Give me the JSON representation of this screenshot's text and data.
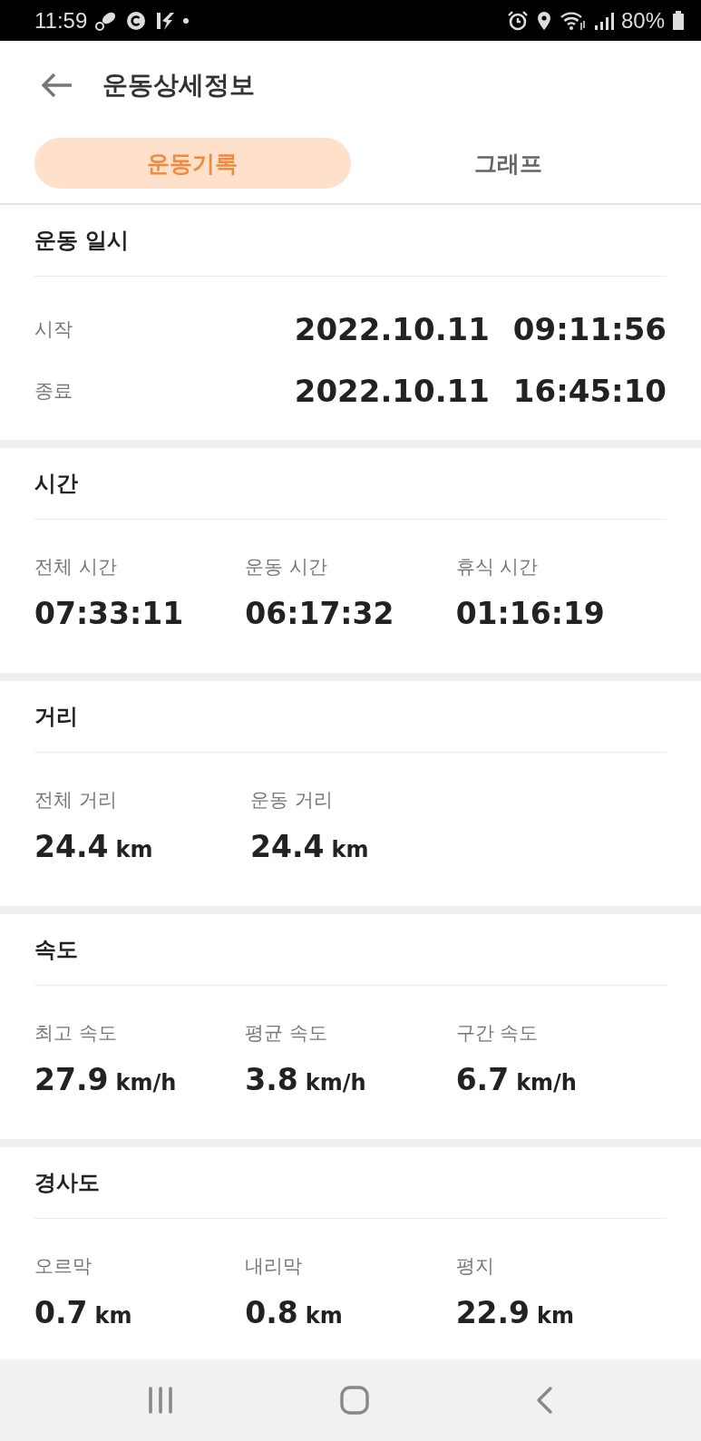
{
  "status_bar": {
    "time": "11:59",
    "battery": "80%"
  },
  "header": {
    "title": "운동상세정보"
  },
  "tabs": [
    {
      "label": "운동기록",
      "selected": true
    },
    {
      "label": "그래프",
      "selected": false
    }
  ],
  "sections": [
    {
      "title": "운동 일시",
      "kind": "datetime",
      "rows": [
        {
          "label": "시작",
          "date": "2022.10.11",
          "time": "09:11:56"
        },
        {
          "label": "종료",
          "date": "2022.10.11",
          "time": "16:45:10"
        }
      ]
    },
    {
      "title": "시간",
      "kind": "stats",
      "stats": [
        {
          "label": "전체 시간",
          "value": "07:33:11"
        },
        {
          "label": "운동 시간",
          "value": "06:17:32"
        },
        {
          "label": "휴식 시간",
          "value": "01:16:19"
        }
      ]
    },
    {
      "title": "거리",
      "kind": "stats",
      "stats": [
        {
          "label": "전체 거리",
          "value": "24.4",
          "unit": "km"
        },
        {
          "label": "운동 거리",
          "value": "24.4",
          "unit": "km"
        }
      ]
    },
    {
      "title": "속도",
      "kind": "stats",
      "stats": [
        {
          "label": "최고 속도",
          "value": "27.9",
          "unit": "km/h"
        },
        {
          "label": "평균 속도",
          "value": "3.8",
          "unit": "km/h"
        },
        {
          "label": "구간 속도",
          "value": "6.7",
          "unit": "km/h"
        }
      ]
    },
    {
      "title": "경사도",
      "kind": "stats",
      "stats": [
        {
          "label": "오르막",
          "value": "0.7",
          "unit": "km"
        },
        {
          "label": "내리막",
          "value": "0.8",
          "unit": "km"
        },
        {
          "label": "평지",
          "value": "22.9",
          "unit": "km"
        }
      ]
    }
  ]
}
